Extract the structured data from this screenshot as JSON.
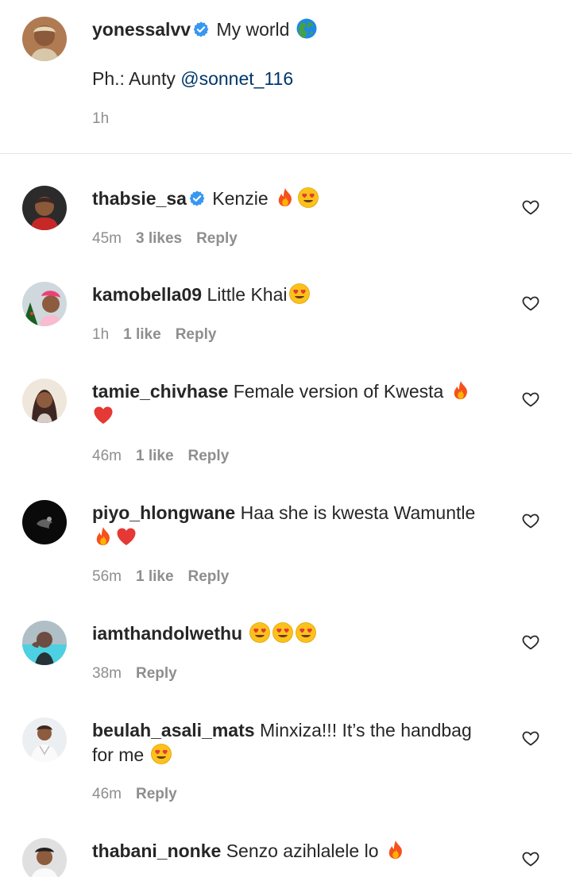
{
  "caption": {
    "username": "yonessalvv",
    "text": "My world",
    "text_emoji": "globe-emoji",
    "line2_prefix": "Ph.: Aunty ",
    "mention": "@sonnet_116",
    "time": "1h"
  },
  "comments": [
    {
      "username": "thabsie_sa",
      "verified": true,
      "text": "Kenzie",
      "emojis": [
        "fire-emoji",
        "heart-eyes-emoji"
      ],
      "time": "45m",
      "likes": "3 likes",
      "reply": "Reply"
    },
    {
      "username": "kamobella09",
      "text": "Little Khai",
      "emojis": [
        "heart-eyes-emoji"
      ],
      "time": "1h",
      "likes": "1 like",
      "reply": "Reply"
    },
    {
      "username": "tamie_chivhase",
      "text": "Female version of Kwesta",
      "emojis": [
        "fire-emoji",
        "red-heart-emoji"
      ],
      "time": "46m",
      "likes": "1 like",
      "reply": "Reply"
    },
    {
      "username": "piyo_hlongwane",
      "text": "Haa she is kwesta Wamuntle",
      "emojis": [
        "fire-emoji",
        "red-heart-emoji"
      ],
      "time": "56m",
      "likes": "1 like",
      "reply": "Reply"
    },
    {
      "username": "iamthandolwethu",
      "text": "",
      "emojis": [
        "heart-eyes-emoji",
        "heart-eyes-emoji",
        "heart-eyes-emoji"
      ],
      "time": "38m",
      "reply": "Reply"
    },
    {
      "username": "beulah_asali_mats",
      "text": "Minxiza!!! It’s the handbag",
      "text_line2": "for me",
      "emojis": [
        "heart-eyes-emoji"
      ],
      "time": "46m",
      "reply": "Reply"
    },
    {
      "username": "thabani_nonke",
      "text": "Senzo azihlalele lo",
      "emojis": [
        "fire-emoji"
      ]
    }
  ],
  "colors": {
    "text": "#262626",
    "meta": "#8e8e8e",
    "mention": "#00376b",
    "verified": "#3897f0",
    "divider": "#e6e6e6"
  }
}
